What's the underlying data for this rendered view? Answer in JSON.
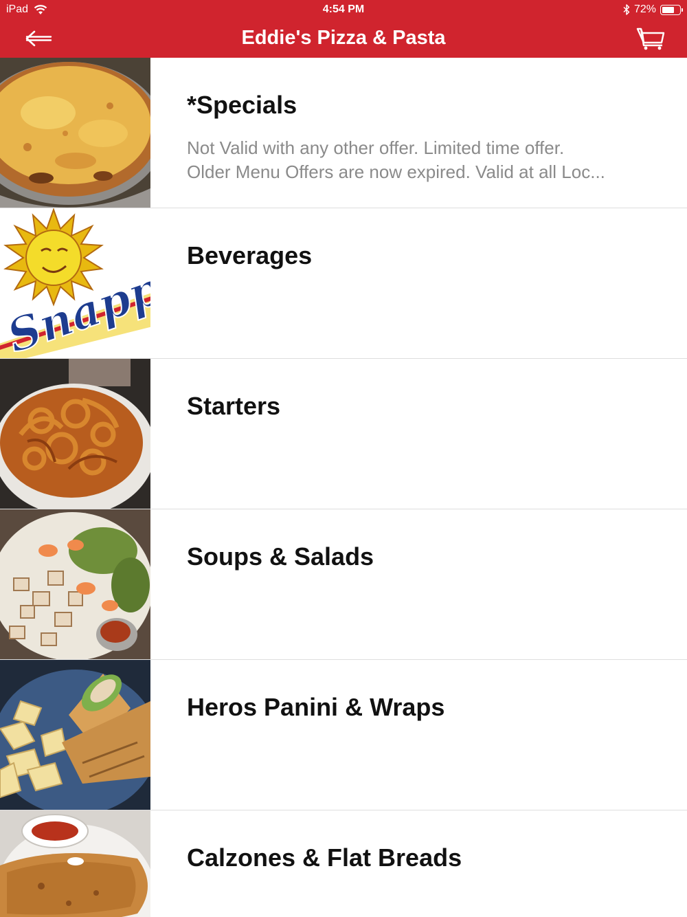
{
  "status_bar": {
    "device": "iPad",
    "time": "4:54 PM",
    "battery": "72%",
    "battery_level": 0.72
  },
  "nav": {
    "title": "Eddie's Pizza & Pasta",
    "back_icon": "back-arrow-icon",
    "cart_icon": "cart-icon"
  },
  "colors": {
    "header": "#d0242e"
  },
  "categories": [
    {
      "title": "*Specials",
      "description_line1": "Not Valid with any other offer. Limited time offer.",
      "description_line2": "Older Menu Offers are now expired. Valid at all Loc...",
      "image": "cheese pizza"
    },
    {
      "title": "Beverages",
      "image": "Snapple logo",
      "logo_text": "Snapple"
    },
    {
      "title": "Starters",
      "image": "bowl of curly fries"
    },
    {
      "title": "Soups & Salads",
      "image": "salad with shrimp and chicken"
    },
    {
      "title": "Heros Panini & Wraps",
      "image": "wrap with chips"
    },
    {
      "title": "Calzones & Flat Breads",
      "image": "calzone with sauce"
    }
  ]
}
